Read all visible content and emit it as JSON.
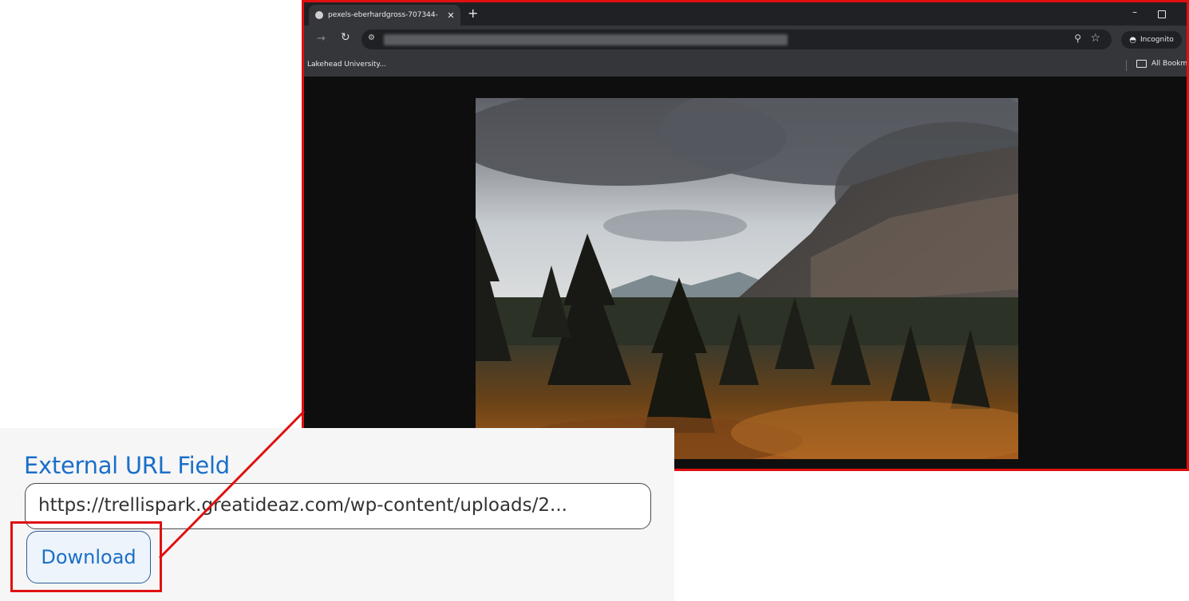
{
  "browser": {
    "tab_title": "pexels-eberhardgross-707344-",
    "tab_close": "✕",
    "new_tab": "+",
    "window_minimize": "–",
    "bookmark_item": "Lakehead University...",
    "all_bookmarks_label": "All Bookm",
    "incognito_label": "Incognito",
    "incognito_icon": "incognito-icon",
    "image_alt": "mountain-forest-landscape-photo"
  },
  "form": {
    "field_label": "External URL Field",
    "url_value": "https://trellispark.greatideaz.com/wp-content/uploads/2...",
    "download_label": "Download"
  },
  "colors": {
    "annotation_red": "#e01010",
    "label_blue": "#1a6fc9",
    "browser_chrome": "#35363a",
    "tab_strip": "#202124"
  }
}
